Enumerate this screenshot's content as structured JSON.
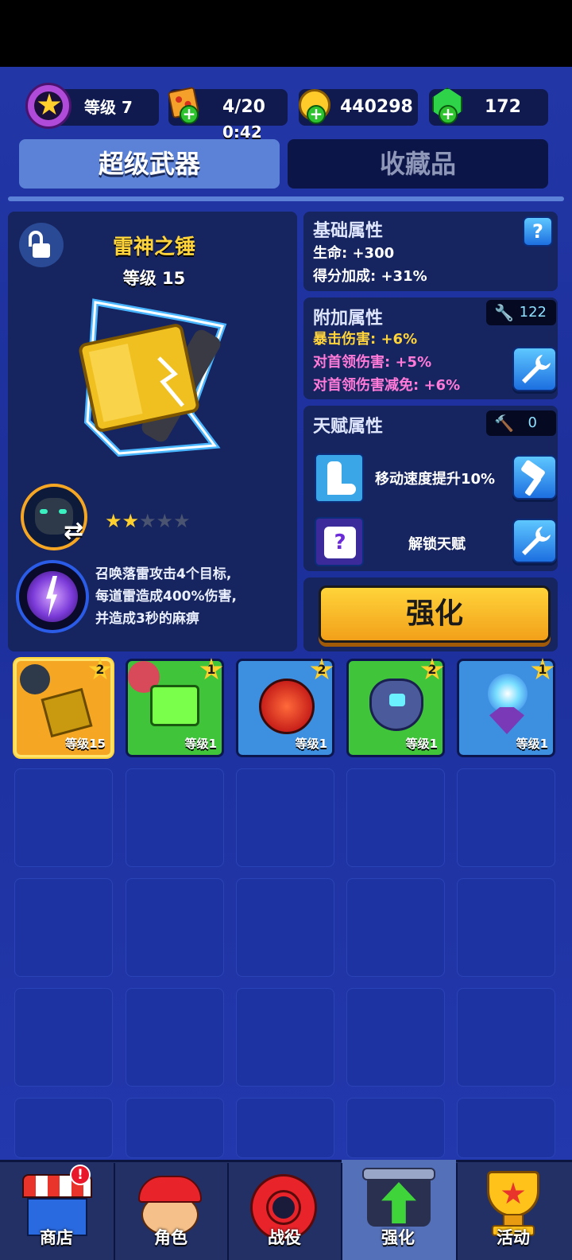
{
  "resources": {
    "level_text": "等级 7",
    "energy": "4/20",
    "energy_timer": "0:42",
    "gold": "440298",
    "gems": "172"
  },
  "tabs": [
    {
      "label": "超级武器",
      "active": true
    },
    {
      "label": "收藏品",
      "active": false
    }
  ],
  "weapon": {
    "name": "雷神之锤",
    "level": "等级 15",
    "stars_filled": 2,
    "stars_total": 5,
    "description_lines": [
      "召唤落雷攻击4个目标,",
      "每道雷造成400%伤害,",
      "并造成3秒的麻痹"
    ]
  },
  "base_attrs": {
    "title": "基础属性",
    "help_icon": "?",
    "items": [
      "生命: +300",
      "得分加成: +31%"
    ]
  },
  "extra_attrs": {
    "title": "附加属性",
    "wrench_count": "122",
    "items": [
      {
        "text": "暴击伤害: +6%",
        "color": "#ffd43a"
      },
      {
        "text": "对首领伤害: +5%",
        "color": "#ff7ad9"
      },
      {
        "text": "对首领伤害减免: +6%",
        "color": "#ff7ad9"
      }
    ]
  },
  "talent_attrs": {
    "title": "天赋属性",
    "hammer_count": "0",
    "talent1": "移动速度提升10%",
    "talent2": "解锁天赋"
  },
  "upgrade_button": "强化",
  "cards": [
    {
      "level": "等级15",
      "badge": "2",
      "color": "#f5a623",
      "selected": true,
      "icon": "hammer-icon"
    },
    {
      "level": "等级1",
      "badge": "1",
      "color": "#3fc43a",
      "selected": false,
      "icon": "green-cube-icon"
    },
    {
      "level": "等级1",
      "badge": "2",
      "color": "#3d8fe0",
      "selected": false,
      "icon": "red-orb-icon"
    },
    {
      "level": "等级1",
      "badge": "2",
      "color": "#3fc43a",
      "selected": false,
      "icon": "shield-drone-icon"
    },
    {
      "level": "等级1",
      "badge": "1",
      "color": "#3d8fe0",
      "selected": false,
      "icon": "crystal-icon"
    }
  ],
  "nav": [
    {
      "label": "商店",
      "icon": "shop-icon",
      "alert": "!"
    },
    {
      "label": "角色",
      "icon": "character-icon"
    },
    {
      "label": "战役",
      "icon": "target-icon"
    },
    {
      "label": "强化",
      "icon": "upgrade-arrow-icon",
      "active": true
    },
    {
      "label": "活动",
      "icon": "trophy-icon"
    }
  ]
}
